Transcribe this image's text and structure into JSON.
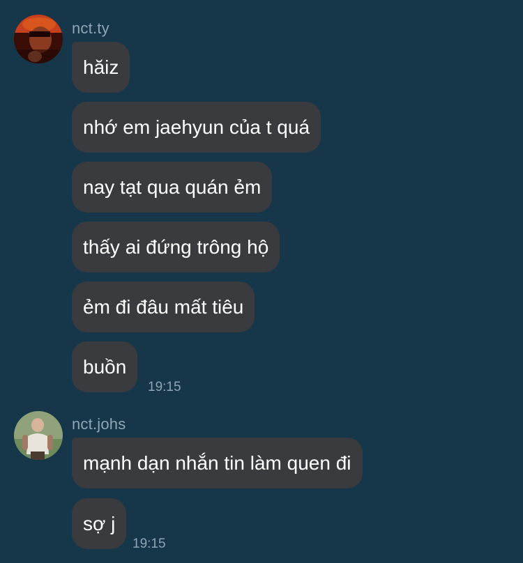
{
  "groups": [
    {
      "sender": "nct.ty",
      "messages": [
        "hăiz",
        "nhớ em jaehyun của t quá",
        "nay tạt qua quán ẻm",
        "thấy ai đứng trông hộ",
        "ẻm đi đâu mất tiêu",
        "buồn"
      ],
      "time": "19:15"
    },
    {
      "sender": "nct.johs",
      "messages": [
        "mạnh dạn nhắn tin làm quen đi",
        "sợ j"
      ],
      "time": "19:15"
    }
  ],
  "colors": {
    "background": "#16364a",
    "bubble": "#3a3b3f",
    "meta_text": "#8ea6b6",
    "message_text": "#ffffff"
  }
}
